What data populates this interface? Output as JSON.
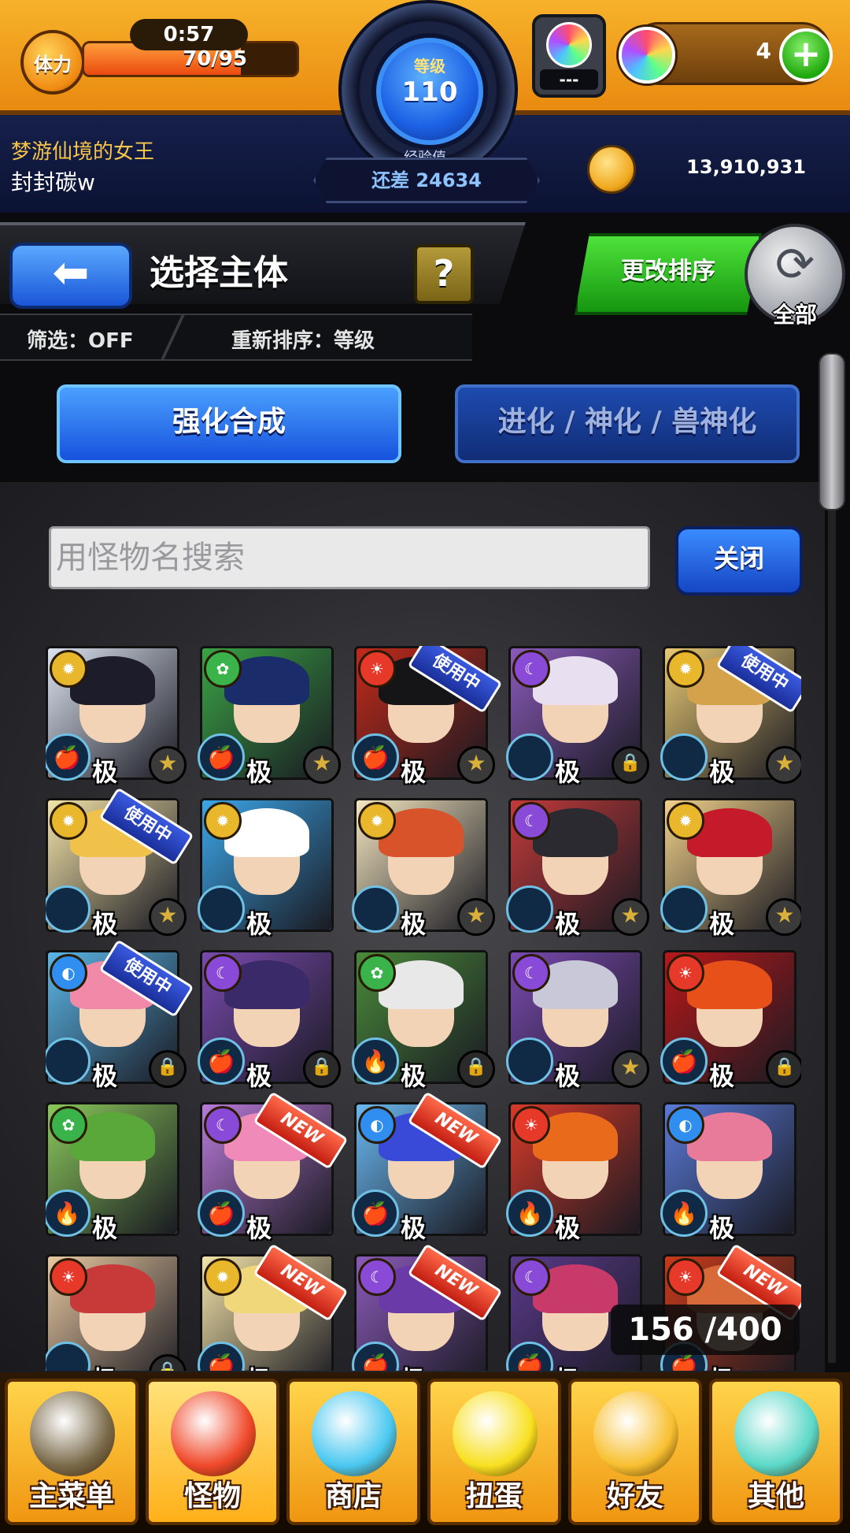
{
  "hud": {
    "stamina_label": "体力",
    "stamina_timer": "0:57",
    "stamina_count": "70/95",
    "stamina_fraction": 0.737,
    "level_label": "等级",
    "level_value": "110",
    "exp_label": "经验值",
    "exp_text": "还差 24634",
    "egg_status": "---",
    "orb_count": "4",
    "player_title": "梦游仙境的女王",
    "player_name": "封封碳w",
    "gold": "13,910,931"
  },
  "header": {
    "title": "选择主体",
    "help_label": "?",
    "back_icon": "arrow-left-icon",
    "filter_text": "筛选：OFF",
    "sort_text": "重新排序：等级",
    "change_sort_label": "更改排序",
    "all_label": "全部"
  },
  "modes": {
    "enhance_label": "强化合成",
    "evolve_label": "进化 / 神化 / 兽神化"
  },
  "search": {
    "placeholder": "用怪物名搜索",
    "close_label": "关闭"
  },
  "rank_label": "极",
  "tags": {
    "in_use": "使用中",
    "new": "NEW"
  },
  "monsters": [
    {
      "element": "light",
      "hair": "#1c1c2a",
      "bg": "#dbe3f0",
      "fruit": "🍎",
      "badge": "star",
      "tag": ""
    },
    {
      "element": "wood",
      "hair": "#1a2c6a",
      "bg": "#3aa345",
      "fruit": "🍎",
      "badge": "star",
      "tag": ""
    },
    {
      "element": "fire",
      "hair": "#151518",
      "bg": "#c22a1a",
      "fruit": "🍎",
      "badge": "star",
      "tag": "in_use"
    },
    {
      "element": "dark",
      "hair": "#e8e0f0",
      "bg": "#8a5ab8",
      "fruit": "",
      "badge": "lock",
      "tag": ""
    },
    {
      "element": "light",
      "hair": "#d3a24a",
      "bg": "#e7c873",
      "fruit": "",
      "badge": "star",
      "tag": "in_use"
    },
    {
      "element": "light",
      "hair": "#f0c24a",
      "bg": "#f3e3a8",
      "fruit": "",
      "badge": "star",
      "tag": "in_use"
    },
    {
      "element": "light",
      "hair": "#ffffff",
      "bg": "#3ba6e8",
      "fruit": "",
      "badge": "",
      "tag": ""
    },
    {
      "element": "light",
      "hair": "#d8532a",
      "bg": "#f4e6c0",
      "fruit": "",
      "badge": "star",
      "tag": ""
    },
    {
      "element": "dark",
      "hair": "#2a2a30",
      "bg": "#c23a3a",
      "fruit": "",
      "badge": "star",
      "tag": ""
    },
    {
      "element": "light",
      "hair": "#c41a2a",
      "bg": "#f0d08a",
      "fruit": "",
      "badge": "star",
      "tag": ""
    },
    {
      "element": "water",
      "hair": "#f08aa8",
      "bg": "#5ab6e8",
      "fruit": "",
      "badge": "lock",
      "tag": "in_use"
    },
    {
      "element": "dark",
      "hair": "#3a2a6a",
      "bg": "#7a4ab0",
      "fruit": "🍎",
      "badge": "lock",
      "tag": ""
    },
    {
      "element": "wood",
      "hair": "#e8e8e8",
      "bg": "#4a8a3a",
      "fruit": "🔥",
      "badge": "lock",
      "tag": ""
    },
    {
      "element": "dark",
      "hair": "#c8c8d8",
      "bg": "#7a4ab0",
      "fruit": "",
      "badge": "star",
      "tag": ""
    },
    {
      "element": "fire",
      "hair": "#e8501a",
      "bg": "#b8181a",
      "fruit": "🍎",
      "badge": "lock",
      "tag": ""
    },
    {
      "element": "wood",
      "hair": "#5aa83a",
      "bg": "#8ac85a",
      "fruit": "🔥",
      "badge": "",
      "tag": ""
    },
    {
      "element": "dark",
      "hair": "#f08ab8",
      "bg": "#b87ad8",
      "fruit": "🍎",
      "badge": "",
      "tag": "new"
    },
    {
      "element": "water",
      "hair": "#3a4ad8",
      "bg": "#6ab8f0",
      "fruit": "🍎",
      "badge": "",
      "tag": "new"
    },
    {
      "element": "fire",
      "hair": "#e86a1a",
      "bg": "#d83a2a",
      "fruit": "🔥",
      "badge": "",
      "tag": ""
    },
    {
      "element": "water",
      "hair": "#e87a9a",
      "bg": "#5a7ad8",
      "fruit": "🔥",
      "badge": "",
      "tag": ""
    },
    {
      "element": "fire",
      "hair": "#c83a3a",
      "bg": "#e8c8a0",
      "fruit": "",
      "badge": "lock",
      "tag": ""
    },
    {
      "element": "light",
      "hair": "#f0d87a",
      "bg": "#f3e3a8",
      "fruit": "🍎",
      "badge": "",
      "tag": "new"
    },
    {
      "element": "dark",
      "hair": "#6a3aa8",
      "bg": "#8a5ab8",
      "fruit": "🍎",
      "badge": "",
      "tag": "new"
    },
    {
      "element": "dark",
      "hair": "#c83a6a",
      "bg": "#5a3a8a",
      "fruit": "🍎",
      "badge": "",
      "tag": ""
    },
    {
      "element": "fire",
      "hair": "#d86a3a",
      "bg": "#c83a1a",
      "fruit": "🍎",
      "badge": "",
      "tag": "new"
    }
  ],
  "box_count": "156 /400",
  "nav": [
    {
      "label": "主菜单",
      "icon": "castle-gate-icon",
      "color": "#7a6a4a"
    },
    {
      "label": "怪物",
      "icon": "monster-icon",
      "color": "#f0482a"
    },
    {
      "label": "商店",
      "icon": "rainbow-orb-icon",
      "color": "#4ac8f0"
    },
    {
      "label": "扭蛋",
      "icon": "gacha-egg-icon",
      "color": "#f8e020"
    },
    {
      "label": "好友",
      "icon": "balloon-friends-icon",
      "color": "#f8c030"
    },
    {
      "label": "其他",
      "icon": "question-diamond-icon",
      "color": "#5ad8c8"
    }
  ],
  "colors": {
    "fire": "#e6392a",
    "water": "#2f8ef0",
    "wood": "#39b34a",
    "light": "#e9b72c",
    "dark": "#8a4ad8"
  }
}
